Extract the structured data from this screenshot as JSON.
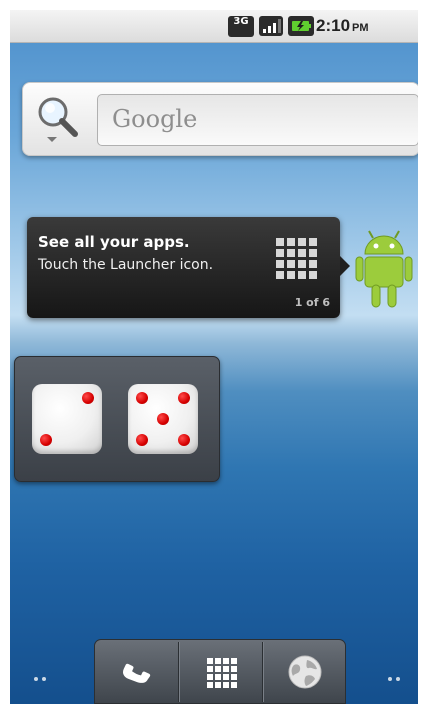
{
  "status_bar": {
    "network_label": "3G",
    "time": "2:10",
    "ampm": "PM",
    "icons": [
      "3g-data-icon",
      "signal-strength-icon",
      "battery-charging-icon"
    ]
  },
  "search_widget": {
    "placeholder": "Google",
    "icon": "search-magnifier-icon"
  },
  "launcher_tip": {
    "title": "See all your apps.",
    "body": "Touch the Launcher icon.",
    "counter": "1 of 6",
    "icon": "launcher-grid-icon"
  },
  "dice_widget": {
    "dice": [
      2,
      5
    ],
    "pip_color": "#d60000"
  },
  "dock": {
    "buttons": [
      {
        "name": "phone",
        "icon": "phone-handset-icon"
      },
      {
        "name": "launcher",
        "icon": "app-grid-icon"
      },
      {
        "name": "browser",
        "icon": "globe-icon"
      }
    ]
  },
  "page_indicators": {
    "left": "previous-page-dots",
    "right": "next-page-dots"
  }
}
